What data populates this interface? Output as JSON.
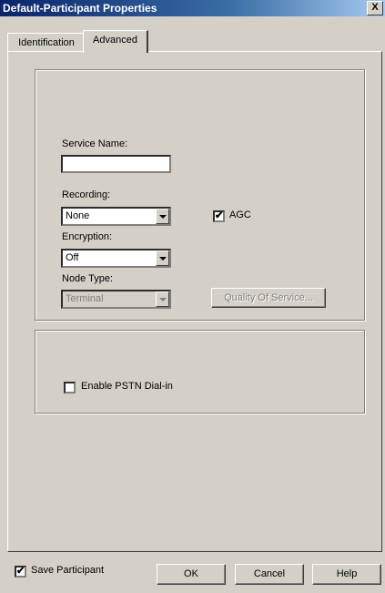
{
  "window": {
    "title": "Default-Participant Properties",
    "close_glyph": "X"
  },
  "tabs": [
    {
      "label": "Identification"
    },
    {
      "label": "Advanced"
    }
  ],
  "fields": {
    "service_name": {
      "label": "Service Name:",
      "value": ""
    },
    "recording": {
      "label": "Recording:",
      "value": "None"
    },
    "agc": {
      "label": "AGC",
      "checked": true,
      "mark": "✔"
    },
    "encryption": {
      "label": "Encryption:",
      "value": "Off"
    },
    "node_type": {
      "label": "Node Type:",
      "value": "Terminal"
    },
    "quality_of_service": {
      "label": "Quality Of Service..."
    },
    "enable_pstn": {
      "label": "Enable PSTN Dial-in",
      "checked": false,
      "mark": ""
    }
  },
  "footer": {
    "save_participant": {
      "label": "Save Participant",
      "checked": true,
      "mark": "✔"
    },
    "ok_label": "OK",
    "cancel_label": "Cancel",
    "help_label": "Help"
  }
}
